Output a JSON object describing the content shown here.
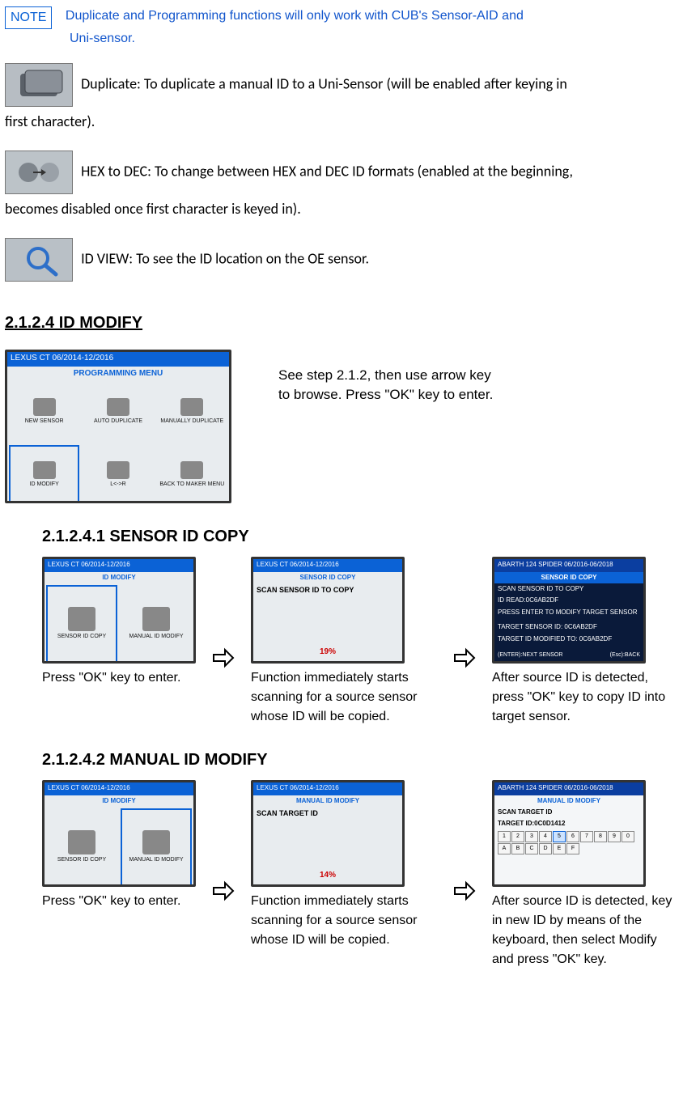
{
  "note": {
    "label": "NOTE",
    "line1": "Duplicate and Programming functions will only work with CUB's Sensor-AID and",
    "line2": "Uni-sensor."
  },
  "funcs": {
    "duplicate": "Duplicate: To duplicate a manual ID to a Uni-Sensor (will be enabled after keying in",
    "duplicate2": "first character).",
    "hexdec": "HEX to DEC: To change between HEX and DEC ID formats (enabled at the beginning,",
    "hexdec2": "becomes disabled once first character is keyed in).",
    "idview": "ID VIEW: To see the ID location on the OE sensor."
  },
  "section_idmodify": "2.1.2.4 ID MODIFY",
  "idmodify_step": "See step 2.1.2, then use arrow key to browse. Press \"OK\" key to enter.",
  "progmenu": {
    "title": "LEXUS  CT  06/2014-12/2016",
    "subtitle": "PROGRAMMING MENU",
    "items": [
      "NEW SENSOR",
      "AUTO DUPLICATE",
      "MANUALLY DUPLICATE",
      "ID MODIFY",
      "L<->R",
      "BACK TO MAKER MENU"
    ]
  },
  "sec_sensoridcopy": "2.1.2.4.1 SENSOR ID COPY",
  "idmodify_menu": {
    "title": "LEXUS  CT  06/2014-12/2016",
    "subtitle": "ID MODIFY",
    "items": [
      "SENSOR ID COPY",
      "MANUAL ID MODIFY"
    ]
  },
  "copy_step1": "Press \"OK\" key to enter.",
  "copy_scan": {
    "title": "LEXUS  CT  06/2014-12/2016",
    "subtitle": "SENSOR ID COPY",
    "body": "SCAN SENSOR ID TO COPY",
    "progress": "19%"
  },
  "copy_step2": "Function immediately starts scanning for a source sensor whose ID will be copied.",
  "copy_result": {
    "title": "ABARTH  124 SPIDER  06/2016-06/2018",
    "subtitle": "SENSOR ID COPY",
    "l1": "SCAN SENSOR ID TO COPY",
    "l2": "ID READ:0C6AB2DF",
    "l3": "PRESS ENTER TO MODIFY TARGET SENSOR",
    "l4": "TARGET SENSOR ID: 0C6AB2DF",
    "l5": "TARGET ID MODIFIED TO: 0C6AB2DF",
    "foot_left": "(ENTER):NEXT SENSOR",
    "foot_right": "(Esc):BACK"
  },
  "copy_step3": "After source ID is detected, press \"OK\" key to copy ID into target sensor.",
  "sec_manualidmodify": "2.1.2.4.2 MANUAL ID MODIFY",
  "mod_step1": "Press \"OK\" key to enter.",
  "mod_scan": {
    "title": "LEXUS  CT  06/2014-12/2016",
    "subtitle": "MANUAL ID MODIFY",
    "body": "SCAN TARGET ID",
    "progress": "14%"
  },
  "mod_step2": "Function immediately starts scanning for a source sensor whose ID will be copied.",
  "mod_result": {
    "title": "ABARTH  124 SPIDER  06/2016-06/2018",
    "subtitle": "MANUAL ID MODIFY",
    "l1": "SCAN TARGET ID",
    "l2": "TARGET ID:0C0D1412",
    "row1": [
      "1",
      "2",
      "3",
      "4",
      "5",
      "6",
      "7",
      "8",
      "9",
      "0"
    ],
    "row2": [
      "A",
      "B",
      "C",
      "D",
      "E",
      "F"
    ]
  },
  "mod_step3": "After source ID is detected, key in new ID by means of the keyboard, then select Modify and press \"OK\" key."
}
